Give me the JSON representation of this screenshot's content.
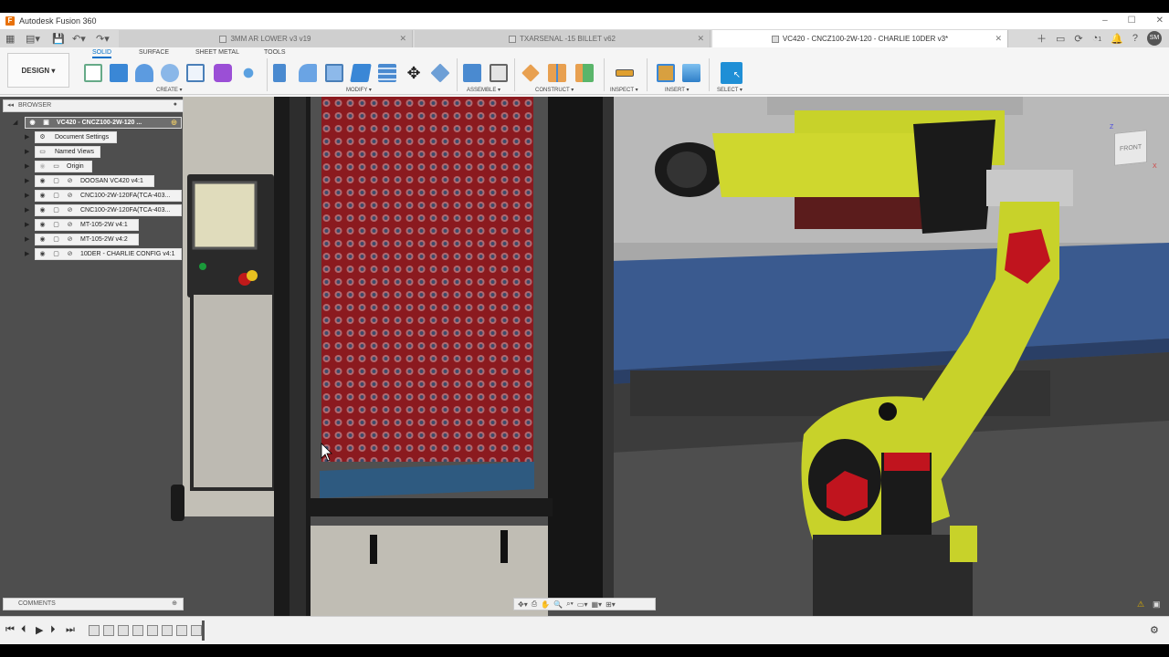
{
  "window": {
    "title": "Autodesk Fusion 360",
    "app_icon": "F"
  },
  "tabs": [
    {
      "label": "3MM AR LOWER v3 v19",
      "active": false
    },
    {
      "label": "TXARSENAL -15 BILLET v62",
      "active": false
    },
    {
      "label": "VC420 - CNCZ100-2W-120 - CHARLIE 10DER v3*",
      "active": true
    }
  ],
  "user": {
    "initials": "SM",
    "notifications": "1"
  },
  "toolbar": {
    "mode_button": "DESIGN ▾",
    "workspace_tabs": [
      "SOLID",
      "SURFACE",
      "SHEET METAL",
      "TOOLS"
    ],
    "groups": [
      "CREATE ▾",
      "MODIFY ▾",
      "ASSEMBLE ▾",
      "CONSTRUCT ▾",
      "INSPECT ▾",
      "INSERT ▾",
      "SELECT ▾"
    ]
  },
  "browser": {
    "title": "BROWSER",
    "root": "VC420 - CNCZ100-2W-120 ...",
    "items": [
      {
        "label": "Document Settings",
        "icon": "gear-icon"
      },
      {
        "label": "Named Views",
        "icon": "folder-icon"
      },
      {
        "label": "Origin",
        "icon": "folder-icon"
      },
      {
        "label": "DOOSAN VC420 v4:1",
        "icon": "link-icon"
      },
      {
        "label": "CNC100-2W-120FA(TCA-403...",
        "icon": "link-icon"
      },
      {
        "label": "CNC100-2W-120FA(TCA-403...",
        "icon": "link-icon"
      },
      {
        "label": "MT-105-2W v4:1",
        "icon": "link-icon"
      },
      {
        "label": "MT-105-2W v4:2",
        "icon": "link-icon"
      },
      {
        "label": "10DER - CHARLIE CONFIG v4:1",
        "icon": "link-icon"
      }
    ]
  },
  "comments": {
    "title": "COMMENTS"
  },
  "viewcube": {
    "label": "FRONT",
    "axis_z": "Z",
    "axis_x": "X"
  },
  "colors": {
    "accent": "#0070c8",
    "robot_yellow": "#c8d22a",
    "conveyor_blue": "#3a5a8f",
    "tray_red": "#8b1a1f"
  }
}
